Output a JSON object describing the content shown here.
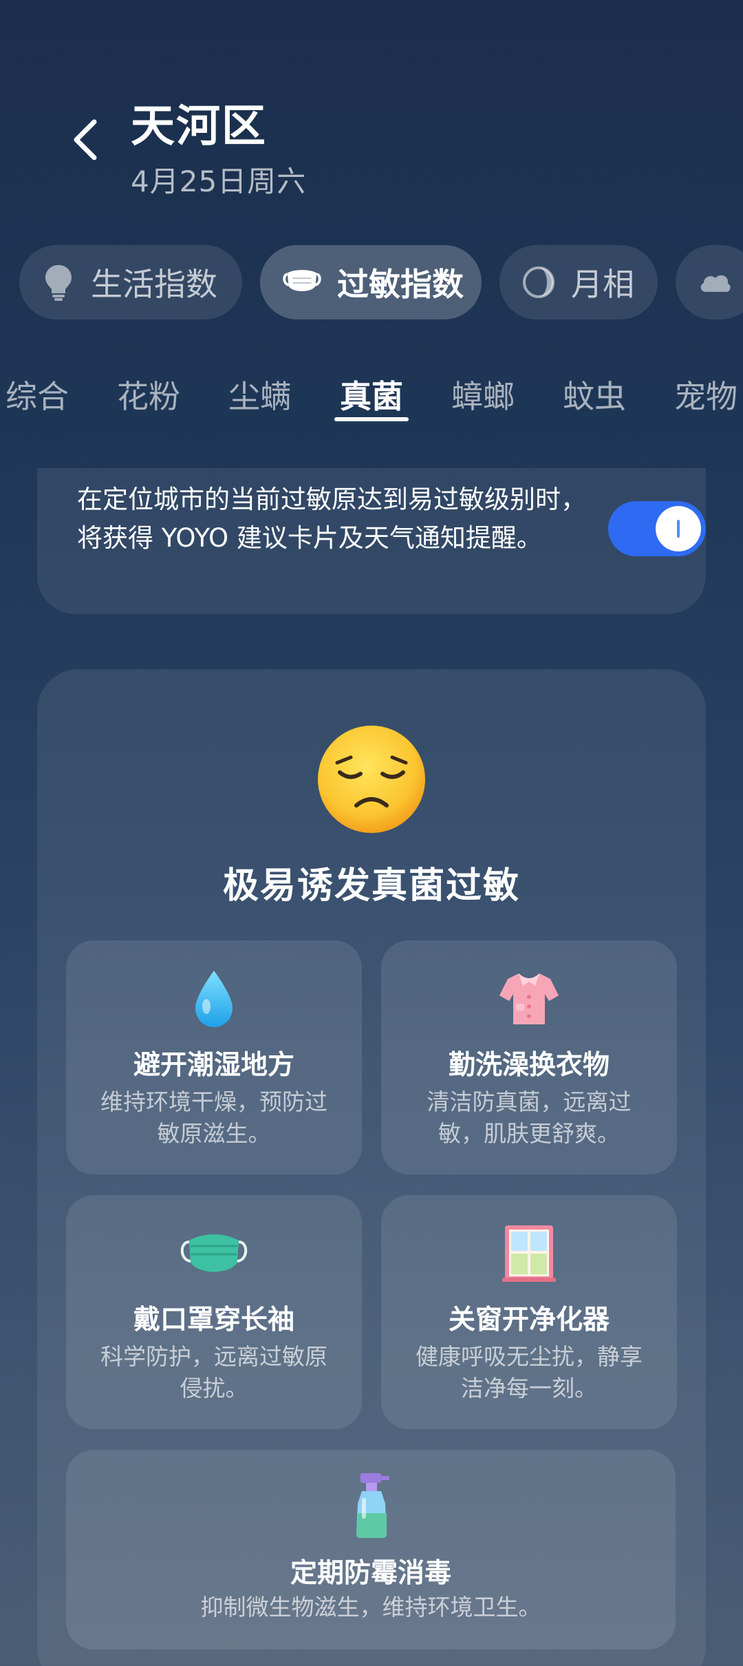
{
  "header": {
    "title": "天河区",
    "date": "4月25日周六"
  },
  "categories": [
    {
      "label": "生活指数",
      "icon": "lightbulb-icon"
    },
    {
      "label": "过敏指数",
      "icon": "mask-icon",
      "active": true
    },
    {
      "label": "月相",
      "icon": "moon-phase-icon"
    },
    {
      "label": "",
      "icon": "cloud-icon"
    }
  ],
  "tabs": [
    {
      "label": "综合"
    },
    {
      "label": "花粉"
    },
    {
      "label": "尘螨"
    },
    {
      "label": "真菌",
      "active": true
    },
    {
      "label": "蟑螂"
    },
    {
      "label": "蚊虫"
    },
    {
      "label": "宠物"
    }
  ],
  "notice": {
    "text": "在定位城市的当前过敏原达到易过敏级别时，将获得 YOYO 建议卡片及天气通知提醒。",
    "toggle_on": true
  },
  "level": {
    "title": "极易诱发真菌过敏",
    "icon": "pensive-face-icon"
  },
  "tips": [
    {
      "icon": "water-drop-icon",
      "title": "避开潮湿地方",
      "desc": "维持环境干燥，预防过敏原滋生。"
    },
    {
      "icon": "shirt-icon",
      "title": "勤洗澡换衣物",
      "desc": "清洁防真菌，远离过敏，肌肤更舒爽。"
    },
    {
      "icon": "face-mask-icon",
      "title": "戴口罩穿长袖",
      "desc": "科学防护，远离过敏原侵扰。"
    },
    {
      "icon": "window-icon",
      "title": "关窗开净化器",
      "desc": "健康呼吸无尘扰，静享洁净每一刻。"
    },
    {
      "icon": "spray-bottle-icon",
      "title": "定期防霉消毒",
      "desc": "抑制微生物滋生，维持环境卫生。"
    }
  ],
  "colors": {
    "accent": "#2f6bf2",
    "background_top": "#1b2e4c",
    "background_bottom": "#4a5d74"
  }
}
